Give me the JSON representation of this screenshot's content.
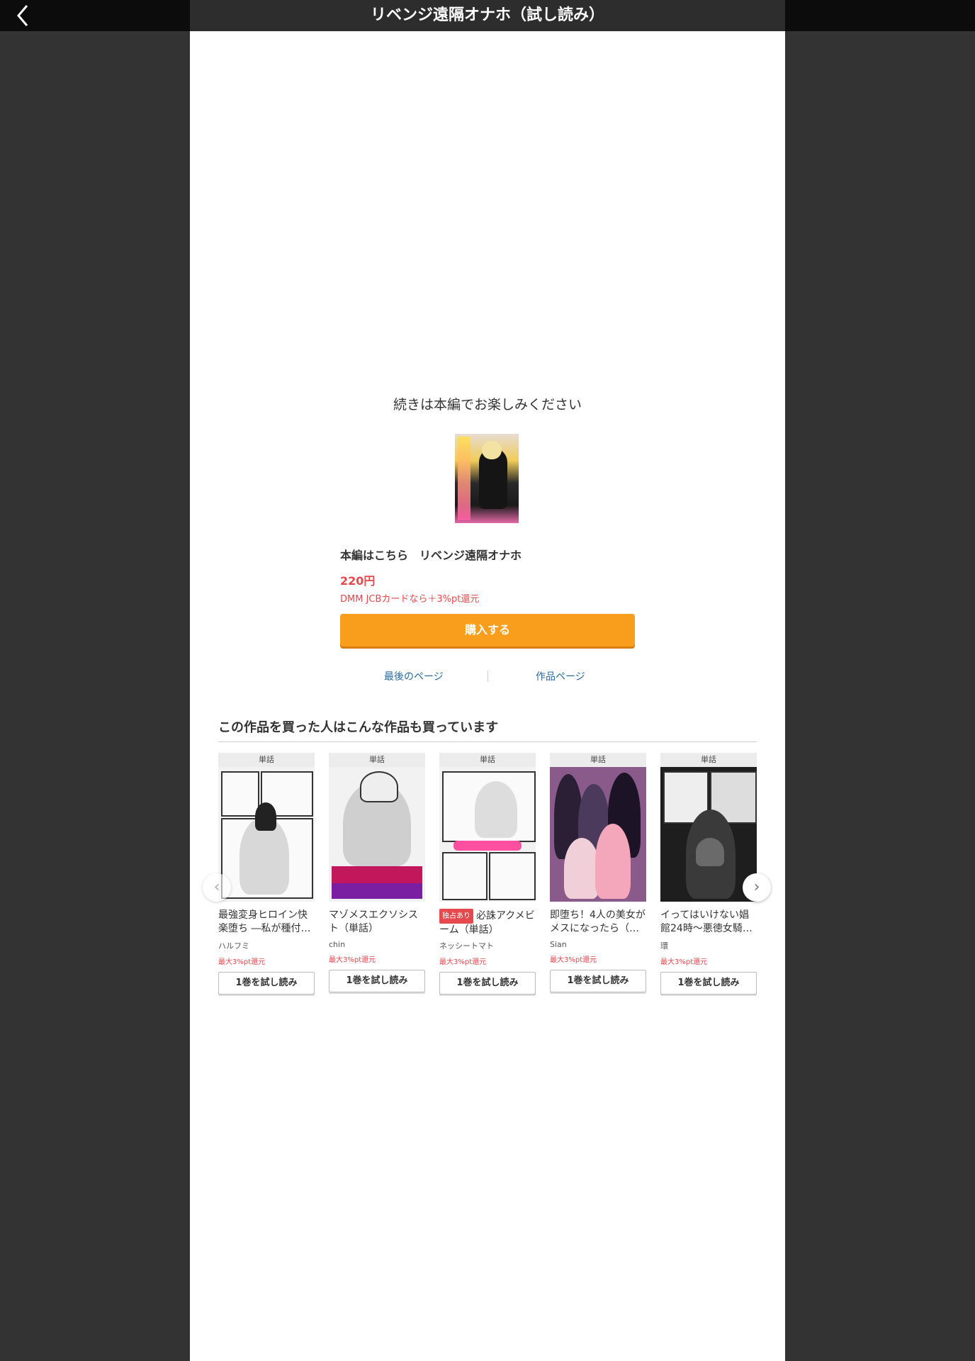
{
  "header": {
    "title": "リベンジ遠隔オナホ（試し読み）",
    "back_icon": "chevron-left-icon"
  },
  "end_of_sample": {
    "message": "続きは本編でお楽しみください",
    "main_link": "本編はこちら　リベンジ遠隔オナホ",
    "price": "220円",
    "point_note": "DMM JCBカードなら＋3%pt還元",
    "buy_label": "購入する",
    "last_page_label": "最後のページ",
    "work_page_label": "作品ページ"
  },
  "recommendations": {
    "heading": "この作品を買った人はこんな作品も買っています",
    "items": [
      {
        "tag": "単話",
        "title": "最強変身ヒロイン快楽堕ち ―私が種付…",
        "author": "ハルフミ",
        "points": "最大3%pt還元",
        "button": "1巻を試し読み",
        "exclusive": ""
      },
      {
        "tag": "単話",
        "title": "マゾメスエクソシスト（単話）",
        "author": "chin",
        "points": "最大3%pt還元",
        "button": "1巻を試し読み",
        "exclusive": ""
      },
      {
        "tag": "単話",
        "title": "必誅アクメビーム（単話）",
        "author": "ネッシートマト",
        "points": "最大3%pt還元",
        "button": "1巻を試し読み",
        "exclusive": "独占あり"
      },
      {
        "tag": "単話",
        "title": "即堕ち！4人の美女がメスになったら（…",
        "author": "Sian",
        "points": "最大3%pt還元",
        "button": "1巻を試し読み",
        "exclusive": ""
      },
      {
        "tag": "単話",
        "title": "イってはいけない娼館24時～悪徳女騎…",
        "author": "環",
        "points": "最大3%pt還元",
        "button": "1巻を試し読み",
        "exclusive": ""
      }
    ]
  },
  "colors": {
    "accent_orange": "#f99d1c",
    "price_red": "#e5484d",
    "link_blue": "#2a6aa1"
  }
}
